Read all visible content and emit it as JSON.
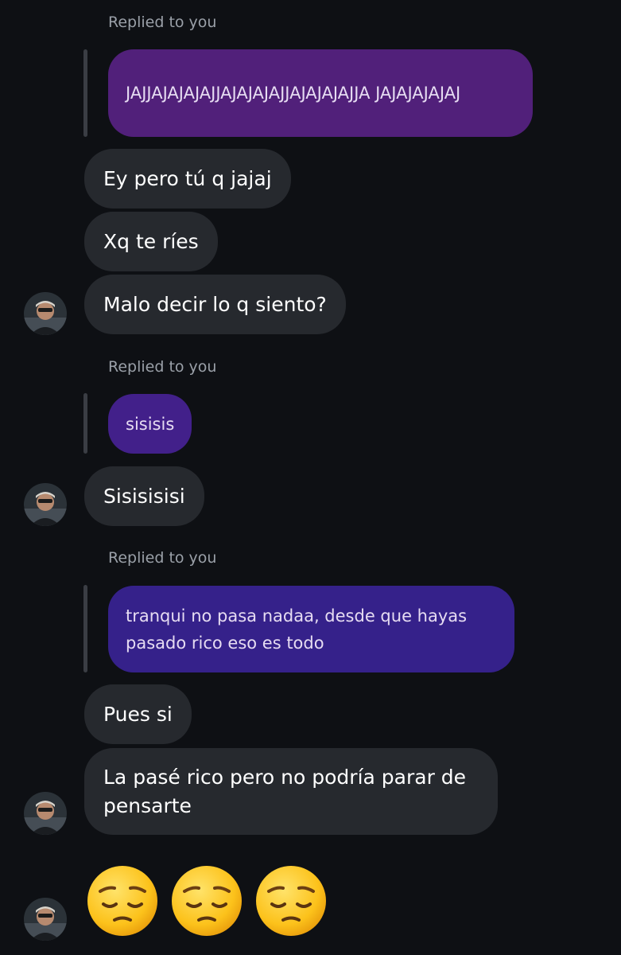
{
  "colors": {
    "background": "#0e1014",
    "incoming_bubble": "#26292e",
    "quoted_bubble_1": "#51207a",
    "quoted_bubble_2": "#42208a",
    "quoted_bubble_3": "#35218a",
    "meta_text": "#9aa0a8"
  },
  "replies": [
    {
      "label": "Replied to you",
      "quoted": "JAJJAJAJAJAJJAJAJAJAJJAJAJAJAJJA JAJAJAJAJAJ"
    },
    {
      "label": "Replied to you",
      "quoted": "sisisis"
    },
    {
      "label": "Replied to you",
      "quoted": "tranqui no pasa nadaa, desde que hayas pasado rico eso es todo"
    }
  ],
  "messages": [
    "Ey pero tú q jajaj",
    "Xq te ríes",
    "Malo decir lo q siento?",
    "Sisisisisi",
    "Pues si",
    "La pasé rico pero no podría parar de pensarte"
  ],
  "emoji_message": {
    "icon": "pensive-face-icon",
    "count": 3
  }
}
